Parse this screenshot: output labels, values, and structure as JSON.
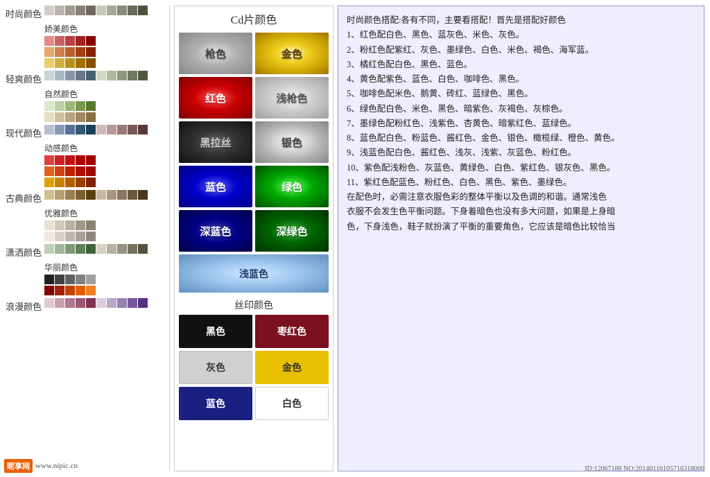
{
  "header": {
    "title": "Cd片颜色"
  },
  "left_panel": {
    "sections": [
      {
        "id": "fashionable",
        "label": "时尚颜色",
        "rows": [
          [
            "#d0cfc8",
            "#b8b5ad",
            "#a09b92",
            "#888078",
            "#706860"
          ],
          [
            "#c8c8b8",
            "#a8a898",
            "#8a8a78",
            "#6a6a58",
            "#505040"
          ]
        ]
      },
      {
        "id": "light",
        "label": "轻爽颜色",
        "rows": [
          [
            "#c8d4d8",
            "#a8b8c0",
            "#8898a8",
            "#687888",
            "#486070"
          ],
          [
            "#d0d8c0",
            "#b0b8a0",
            "#909880",
            "#707860",
            "#505840"
          ]
        ]
      },
      {
        "id": "modern",
        "label": "现代颜色",
        "rows": [
          [
            "#b8c0d0",
            "#8898b8",
            "#587098",
            "#385878",
            "#184058"
          ],
          [
            "#d0b8b8",
            "#b89898",
            "#987878",
            "#785858",
            "#583838"
          ]
        ]
      },
      {
        "id": "classic",
        "label": "古典颜色",
        "rows": [
          [
            "#d0c090",
            "#b8a070",
            "#988050",
            "#786030",
            "#584010"
          ],
          [
            "#c8b8a0",
            "#a89880",
            "#887860",
            "#685840",
            "#483820"
          ]
        ]
      },
      {
        "id": "elegant_life",
        "label": "潇洒颜色",
        "rows": [
          [
            "#c0d0b8",
            "#a0b898",
            "#809878",
            "#608058",
            "#406038"
          ],
          [
            "#d8d0c0",
            "#b8b0a0",
            "#989080",
            "#787060",
            "#585040"
          ]
        ]
      },
      {
        "id": "romantic",
        "label": "浪漫颜色",
        "rows": [
          [
            "#e0c8d0",
            "#c8a0b0",
            "#b07890",
            "#985870",
            "#803050"
          ],
          [
            "#d8d0e0",
            "#b8a8c8",
            "#9880b0",
            "#785898",
            "#583080"
          ]
        ]
      }
    ],
    "right_sections": [
      {
        "id": "charming",
        "label": "娇美颜色",
        "rows": [
          [
            "#e88888",
            "#d06060",
            "#b84040",
            "#a02020",
            "#880000"
          ],
          [
            "#e8a868",
            "#d08048",
            "#b86030",
            "#a04010",
            "#882000"
          ],
          [
            "#e8d068",
            "#d0b040",
            "#b89020",
            "#a07000",
            "#885000"
          ]
        ]
      },
      {
        "id": "natural",
        "label": "自然颜色",
        "rows": [
          [
            "#d8e8c8",
            "#b8d0a0",
            "#98b878",
            "#789850",
            "#587830"
          ],
          [
            "#e8dcc0",
            "#d0c0a0",
            "#b8a480",
            "#a08860",
            "#887040"
          ]
        ]
      },
      {
        "id": "dynamic",
        "label": "动感颜色",
        "rows": [
          [
            "#e04040",
            "#d02020",
            "#c01010",
            "#b00000",
            "#a00000"
          ],
          [
            "#e06020",
            "#d04010",
            "#c02000",
            "#b01000",
            "#a00800"
          ],
          [
            "#e0a000",
            "#c88000",
            "#b06000",
            "#984000",
            "#802000"
          ]
        ]
      },
      {
        "id": "elegant",
        "label": "优雅颜色",
        "rows": [
          [
            "#e8e0d0",
            "#d0c8b8",
            "#b8b0a0",
            "#a09888",
            "#888070"
          ],
          [
            "#f0e8e0",
            "#d8d0c8",
            "#c0b8b0",
            "#a8a098",
            "#908880"
          ]
        ]
      },
      {
        "id": "gorgeous",
        "label": "华丽颜色",
        "rows": [
          [
            "#202020",
            "#404040",
            "#606060",
            "#808080",
            "#a0a0a0"
          ],
          [
            "#800000",
            "#a02000",
            "#c04000",
            "#e06000",
            "#f08020"
          ]
        ]
      }
    ]
  },
  "middle_panel": {
    "title": "Cd片颜色",
    "cd_colors": [
      {
        "id": "gun",
        "label": "枪色",
        "class": "cd-gray"
      },
      {
        "id": "gold",
        "label": "金色",
        "class": "cd-gold"
      },
      {
        "id": "red",
        "label": "红色",
        "class": "cd-red"
      },
      {
        "id": "lightgun",
        "label": "浅枪色",
        "class": "cd-lightgun"
      },
      {
        "id": "blacksilk",
        "label": "黑拉丝",
        "class": "cd-blacksilk"
      },
      {
        "id": "silver",
        "label": "银色",
        "class": "cd-silver"
      },
      {
        "id": "blue",
        "label": "蓝色",
        "class": "cd-blue"
      },
      {
        "id": "green",
        "label": "绿色",
        "class": "cd-green"
      },
      {
        "id": "darkblue",
        "label": "深蓝色",
        "class": "cd-darkblue"
      },
      {
        "id": "darkgreen",
        "label": "深绿色",
        "class": "cd-darkgreen"
      }
    ],
    "light_blue_label": "浅蓝色",
    "silk_title": "丝印颜色",
    "silk_colors": [
      {
        "id": "black",
        "label": "黑色",
        "bg": "#111111",
        "color": "#ffffff"
      },
      {
        "id": "dark_red",
        "label": "枣红色",
        "bg": "#7a1020",
        "color": "#ffffff"
      },
      {
        "id": "gray",
        "label": "灰色",
        "bg": "#d0d0d0",
        "color": "#333333"
      },
      {
        "id": "silk_gold",
        "label": "金色",
        "bg": "#e8c000",
        "color": "#333333"
      },
      {
        "id": "navy",
        "label": "蓝色",
        "bg": "#1a2080",
        "color": "#ffffff"
      },
      {
        "id": "white",
        "label": "白色",
        "bg": "#ffffff",
        "color": "#333333",
        "border": "1px solid #ccc"
      }
    ]
  },
  "right_panel": {
    "text_lines": [
      "时尚颜色搭配:各有不同，主要看搭配！首先是搭配好颜色",
      "1、红色配白色、黑色、蓝灰色、米色、灰色。",
      "2、粉红色配紫红、灰色、墨绿色、白色、米色、褐色、海军蓝。",
      "3、橘红色配白色、黑色、蓝色。",
      "4、黄色配紫色、蓝色、白色、咖啡色、黑色。",
      "5、咖啡色配米色、鹅黄、砖红、蓝绿色、黑色。",
      "6、绿色配白色、米色、黑色、暗紫色、灰褐色、灰棕色。",
      "7、墨绿色配粉红色、浅紫色、杏黄色、暗紫红色、蓝绿色。",
      "8、蓝色配白色、粉蓝色、酱红色、金色、银色、橄榄绿、橙色、黄色。",
      "9、浅蓝色配白色、酱红色、浅灰、浅紫、灰蓝色、粉红色。",
      "10、紫色配浅粉色、灰蓝色、黄绿色、白色、紫红色、银灰色、黑色。",
      "11、紫红色配蓝色、粉红色、白色、黑色、紫色、墨绿色。",
      "在配色时，必需注意衣服色彩的整体平衡以及色调的和谐。通常浅色",
      "衣服不会发生色平衡问题。下身着暗色也没有多大问题，如果是上身暗",
      "色，下身浅色，鞋子就扮演了平衡的重要角色，它应该是暗色比较恰当"
    ]
  },
  "watermark": {
    "logo": "昵享网",
    "url": "www.nipic.cn",
    "id": "ID:12067188 NO:20140116105716318000"
  }
}
